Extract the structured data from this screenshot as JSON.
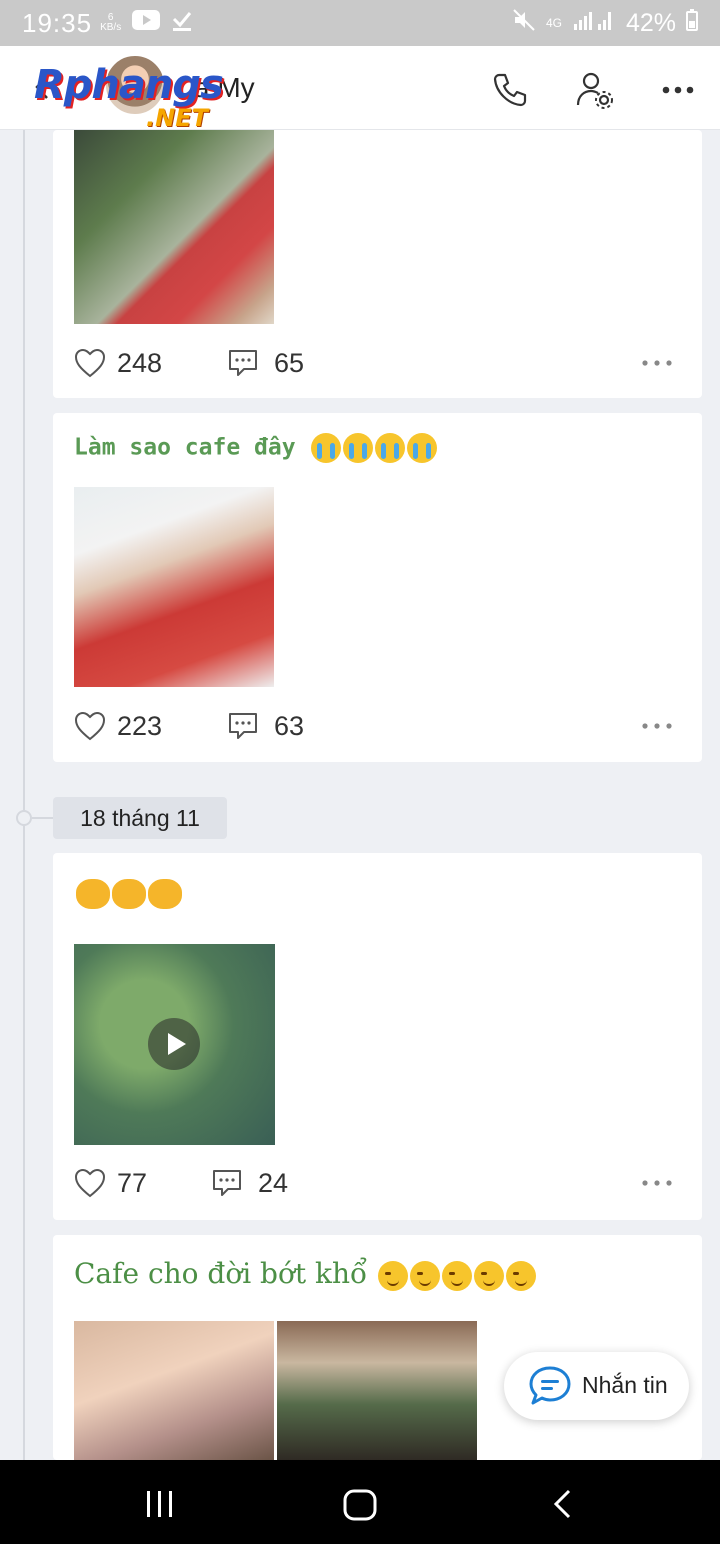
{
  "status_bar": {
    "time": "19:35",
    "net_speed_top": "6",
    "net_speed_bottom": "KB/s",
    "network": "4G",
    "battery": "42%"
  },
  "header": {
    "logo_word": "Rphangs",
    "logo_suffix": ".NET",
    "contact_name": "a My"
  },
  "posts": [
    {
      "caption": "",
      "likes": "248",
      "comments": "65"
    },
    {
      "caption": "Làm sao cafe đây",
      "likes": "223",
      "comments": "63"
    },
    {
      "caption": "",
      "likes": "77",
      "comments": "24"
    },
    {
      "caption": "Cafe cho đời bớt khổ"
    }
  ],
  "timeline": {
    "date_label": "18 tháng 11"
  },
  "floating": {
    "message_label": "Nhắn tin"
  },
  "colors": {
    "caption_green": "#5a9a55",
    "message_blue": "#1d7fd4",
    "status_bar": "#c9c9c9"
  },
  "icons": [
    "back-icon",
    "phone-icon",
    "user-settings-icon",
    "more-icon",
    "heart-icon",
    "comment-icon",
    "play-icon",
    "chat-icon",
    "recent-apps-icon",
    "home-icon",
    "nav-back-icon"
  ]
}
